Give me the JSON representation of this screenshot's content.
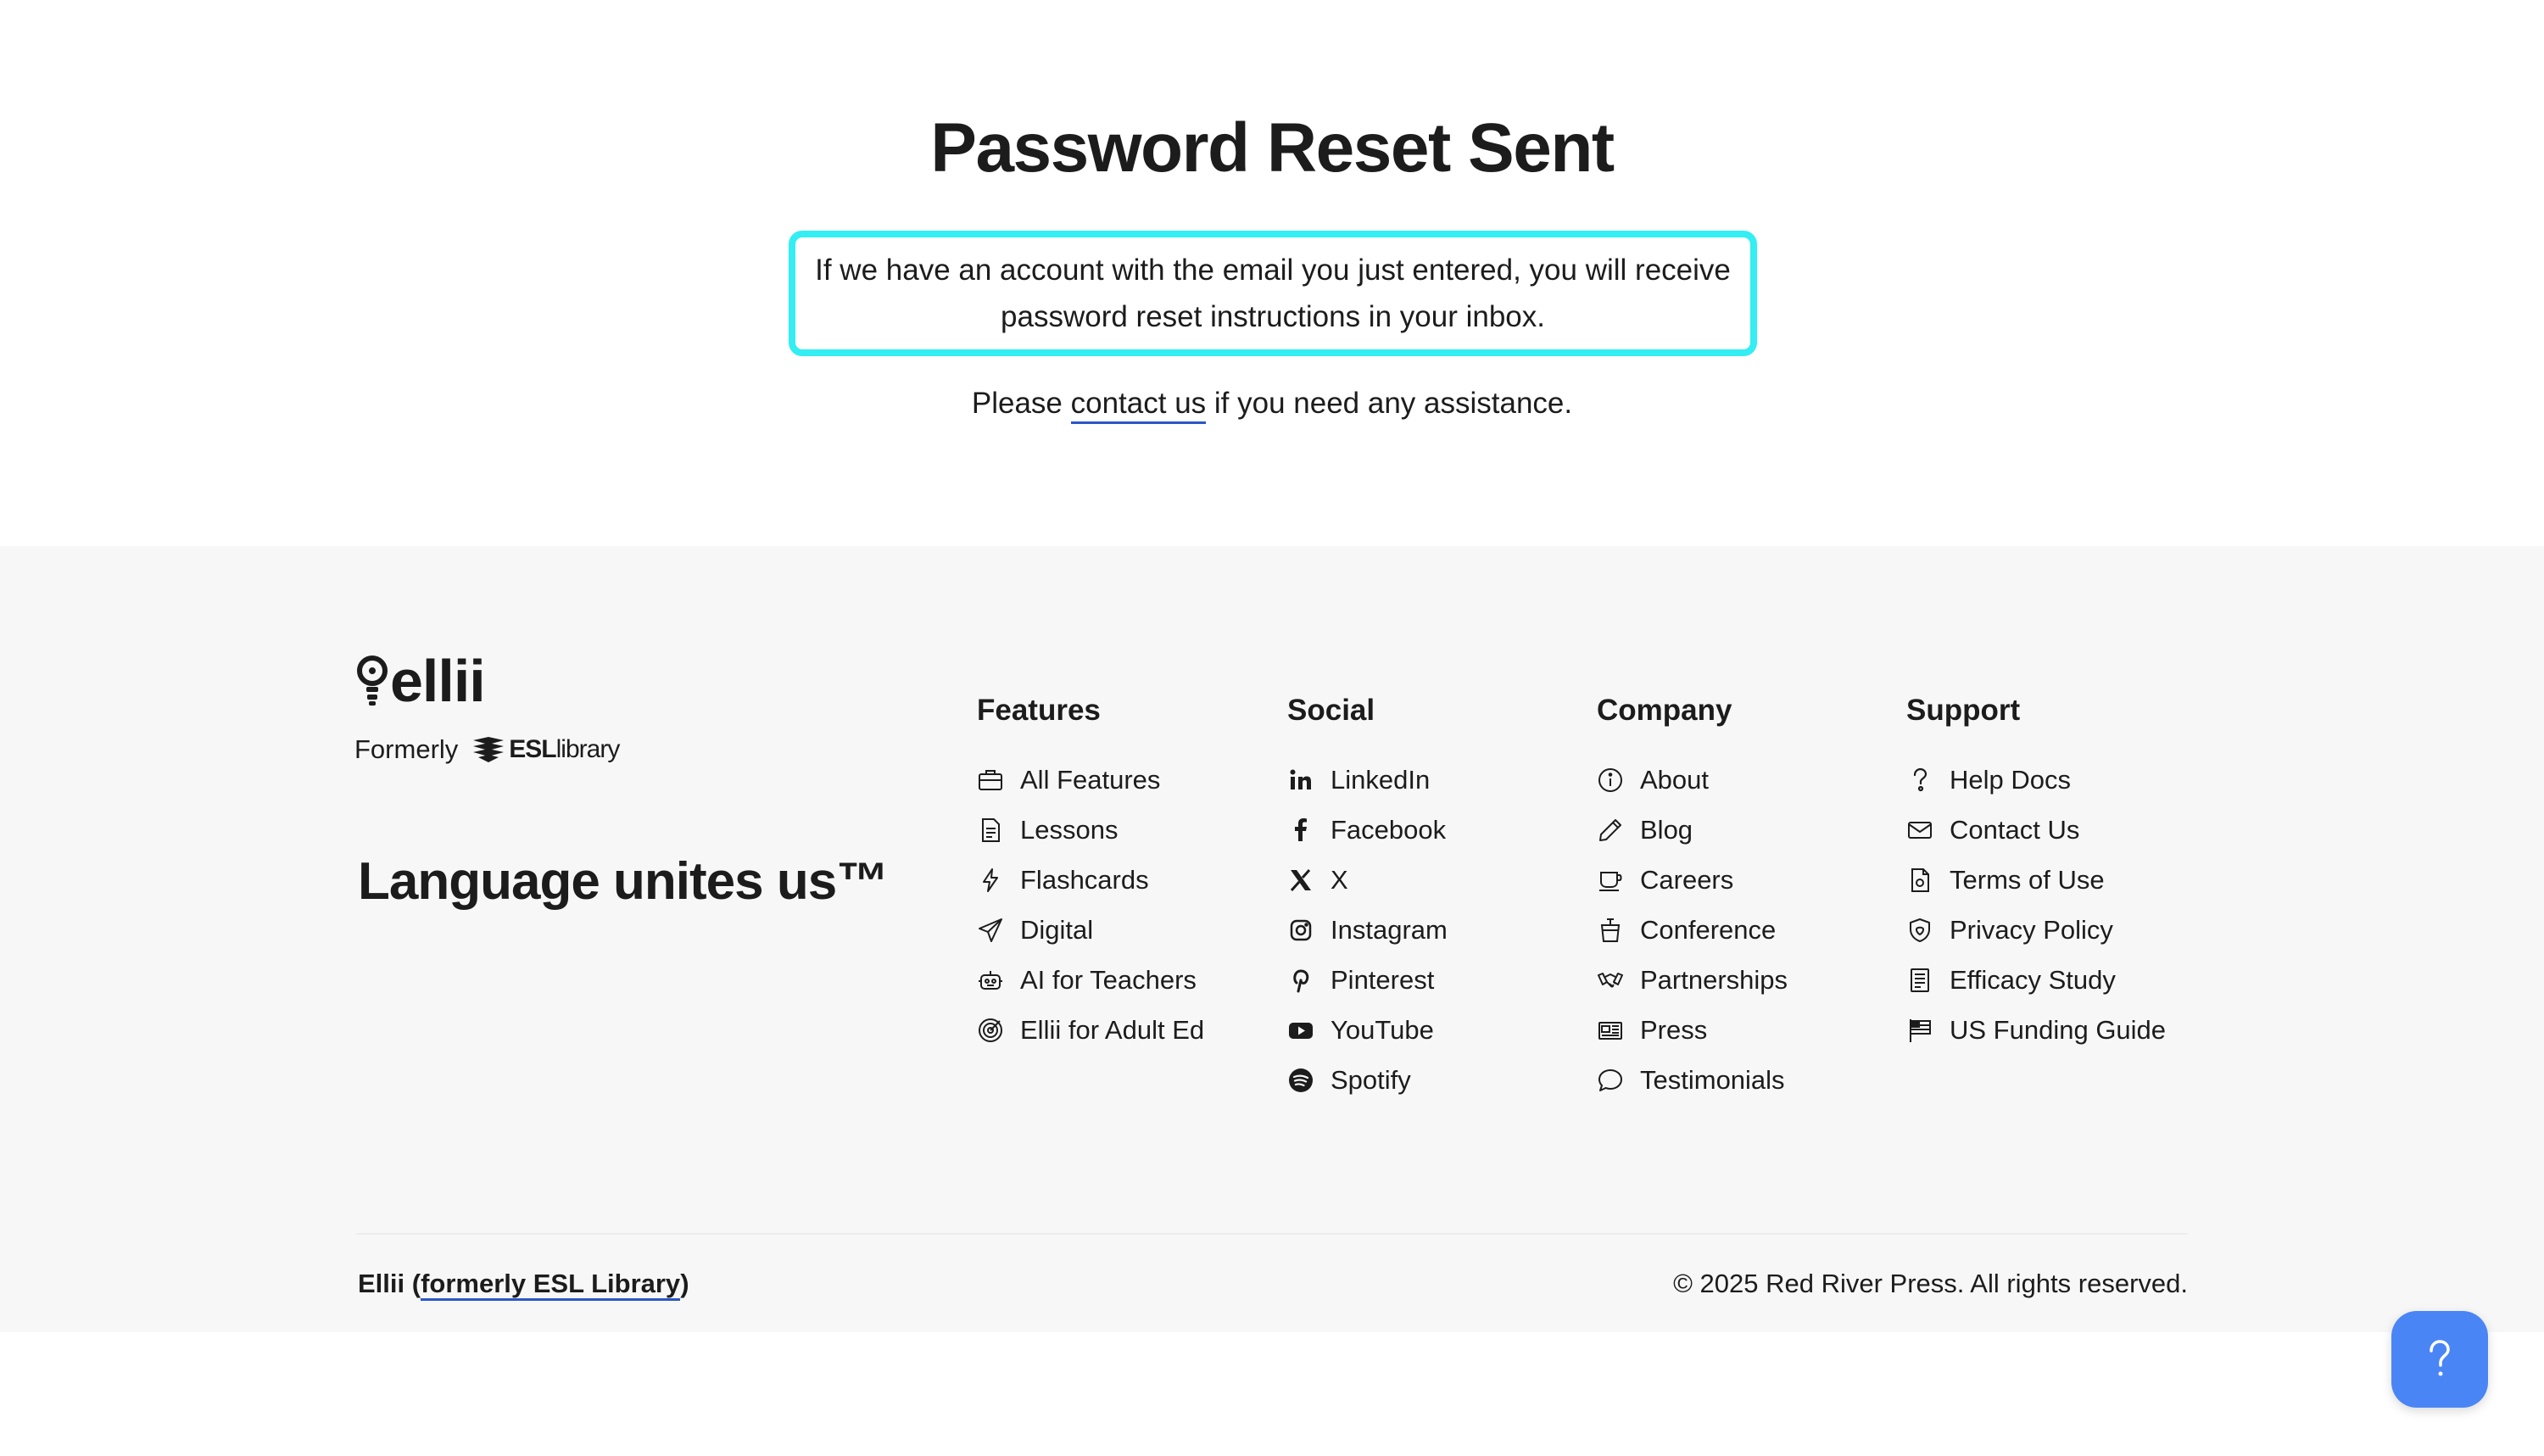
{
  "reset": {
    "title": "Password Reset Sent",
    "notice": "If we have an account with the email you just entered, you will receive password reset instructions in your inbox.",
    "assist_before": "Please ",
    "assist_link": "contact us",
    "assist_after": " if you need any assistance."
  },
  "footer": {
    "brand": {
      "logo_text": "ellii",
      "formerly": "Formerly",
      "esl_bold": "ESL",
      "esl_rest": "library",
      "tagline": "Language unites us™"
    },
    "features": {
      "heading": "Features",
      "items": [
        {
          "label": "All Features",
          "icon": "briefcase-icon"
        },
        {
          "label": "Lessons",
          "icon": "document-icon"
        },
        {
          "label": "Flashcards",
          "icon": "lightning-icon"
        },
        {
          "label": "Digital",
          "icon": "paper-plane-icon"
        },
        {
          "label": "AI for Teachers",
          "icon": "robot-icon"
        },
        {
          "label": "Ellii for Adult Ed",
          "icon": "target-icon"
        }
      ]
    },
    "social": {
      "heading": "Social",
      "items": [
        {
          "label": "LinkedIn",
          "icon": "linkedin-icon"
        },
        {
          "label": "Facebook",
          "icon": "facebook-icon"
        },
        {
          "label": "X",
          "icon": "x-icon"
        },
        {
          "label": "Instagram",
          "icon": "instagram-icon"
        },
        {
          "label": "Pinterest",
          "icon": "pinterest-icon"
        },
        {
          "label": "YouTube",
          "icon": "youtube-icon"
        },
        {
          "label": "Spotify",
          "icon": "spotify-icon"
        }
      ]
    },
    "company": {
      "heading": "Company",
      "items": [
        {
          "label": "About",
          "icon": "info-icon"
        },
        {
          "label": "Blog",
          "icon": "pencil-icon"
        },
        {
          "label": "Careers",
          "icon": "coffee-cup-icon"
        },
        {
          "label": "Conference",
          "icon": "podium-icon"
        },
        {
          "label": "Partnerships",
          "icon": "handshake-icon"
        },
        {
          "label": "Press",
          "icon": "newspaper-icon"
        },
        {
          "label": "Testimonials",
          "icon": "speech-bubble-icon"
        }
      ]
    },
    "support": {
      "heading": "Support",
      "items": [
        {
          "label": "Help Docs",
          "icon": "question-icon"
        },
        {
          "label": "Contact Us",
          "icon": "envelope-icon"
        },
        {
          "label": "Terms of Use",
          "icon": "file-icon"
        },
        {
          "label": "Privacy Policy",
          "icon": "shield-icon"
        },
        {
          "label": "Efficacy Study",
          "icon": "report-icon"
        },
        {
          "label": "US Funding Guide",
          "icon": "flag-icon"
        }
      ]
    },
    "bottom": {
      "company_name": "Ellii (",
      "formerly_link": "formerly ESL Library",
      "close_paren": ")",
      "copyright": "© 2025 Red River Press. All rights reserved."
    }
  },
  "help_button": {
    "icon": "question-mark-icon",
    "color": "#4a85f5"
  },
  "colors": {
    "highlight_border": "#33eef2",
    "link_underline": "#2a56c6",
    "footer_bg": "#f7f7f7"
  }
}
